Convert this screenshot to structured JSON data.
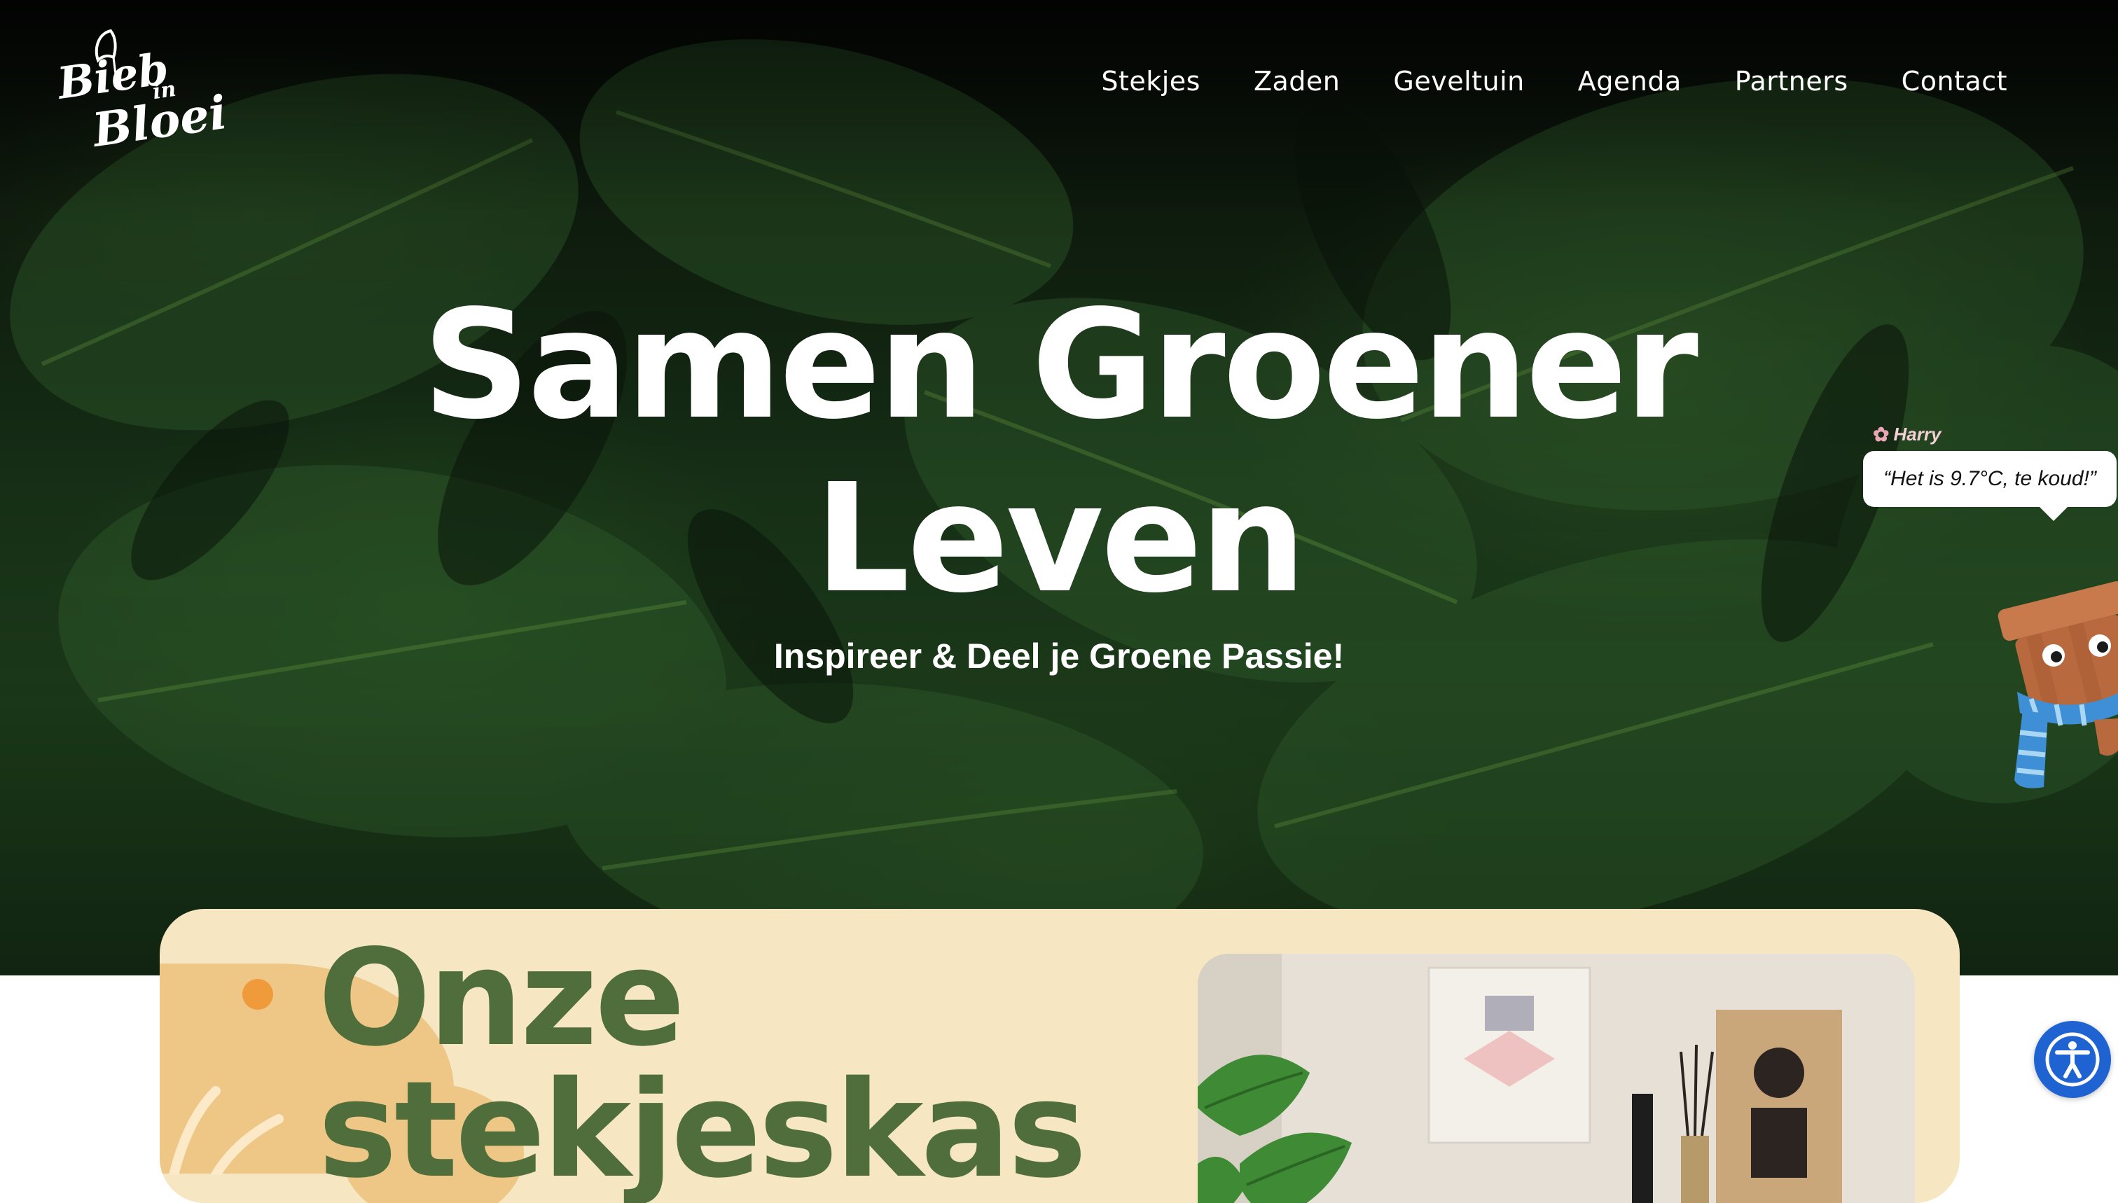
{
  "brand": {
    "logo_line1": "Bieb",
    "logo_line2": "in",
    "logo_line3": "Bloei"
  },
  "nav": {
    "items": [
      {
        "label": "Stekjes"
      },
      {
        "label": "Zaden"
      },
      {
        "label": "Geveltuin"
      },
      {
        "label": "Agenda"
      },
      {
        "label": "Partners"
      },
      {
        "label": "Contact"
      }
    ]
  },
  "hero": {
    "title_line1": "Samen Groener",
    "title_line2": "Leven",
    "subtitle": "Inspireer & Deel je Groene Passie!"
  },
  "mascot": {
    "name": "Harry",
    "flower_icon": "flower-icon",
    "message": "“Het is 9.7°C, te koud!”"
  },
  "section": {
    "title_line1": "Onze",
    "title_line2": "stekjeskas"
  },
  "accessibility": {
    "icon": "accessibility-icon",
    "color": "#1f63d3"
  },
  "colors": {
    "card_bg": "#f6e6c2",
    "title_green": "#4f6e3b",
    "accent_orange": "#ef9a3b"
  }
}
